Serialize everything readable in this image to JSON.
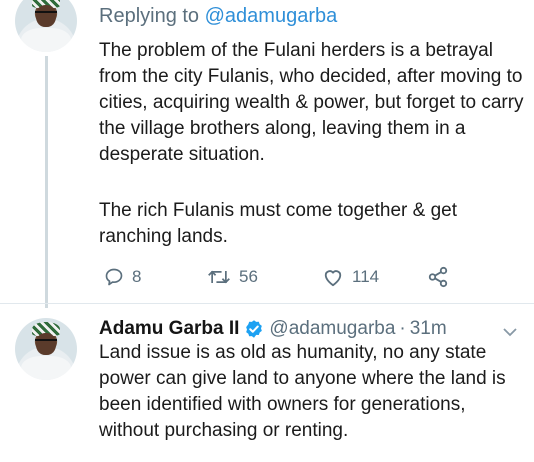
{
  "colors": {
    "link": "#2f8fd8",
    "muted": "#5b6f7d",
    "text": "#1b1b1b",
    "verified": "#1da1f2",
    "divider": "#e1e8ed"
  },
  "tweet1": {
    "replying_label": "Replying to",
    "replying_handle": "@adamugarba",
    "paragraph1": "The problem of the Fulani herders is a betrayal from the city Fulanis, who decided, after moving to cities, acquiring wealth & power, but forget to carry the village brothers along, leaving them in a desperate situation.",
    "paragraph2": "The rich Fulanis must come together & get ranching lands.",
    "actions": {
      "reply_icon": "comment-icon",
      "reply_count": "8",
      "retweet_icon": "retweet-icon",
      "retweet_count": "56",
      "like_icon": "heart-icon",
      "like_count": "114",
      "share_icon": "share-icon"
    }
  },
  "tweet2": {
    "name": "Adamu Garba II",
    "verified_icon": "verified-badge-icon",
    "handle": "@adamugarba",
    "separator": "·",
    "time": "31m",
    "menu_icon": "chevron-down-icon",
    "text": "Land issue is as old as humanity, no any state power can give land to anyone where the land is been identified with owners for generations, without purchasing or renting."
  }
}
